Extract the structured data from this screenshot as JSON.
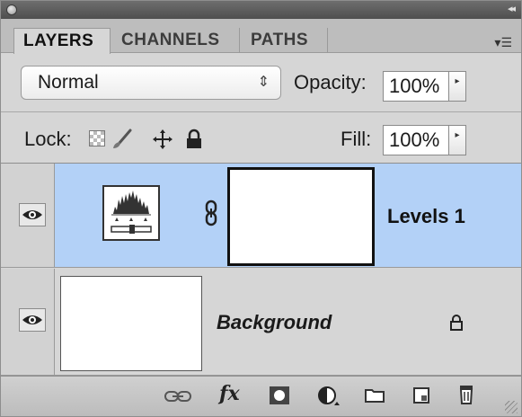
{
  "tabs": [
    {
      "label": "LAYERS",
      "active": true
    },
    {
      "label": "CHANNELS",
      "active": false
    },
    {
      "label": "PATHS",
      "active": false
    }
  ],
  "blend_mode": {
    "value": "Normal"
  },
  "opacity": {
    "label": "Opacity:",
    "value": "100%"
  },
  "lock": {
    "label": "Lock:"
  },
  "fill": {
    "label": "Fill:",
    "value": "100%"
  },
  "layers": [
    {
      "name": "Levels 1",
      "visible": true,
      "selected": true,
      "type": "adjustment-levels",
      "has_mask": true
    },
    {
      "name": "Background",
      "visible": true,
      "selected": false,
      "type": "pixel",
      "locked": true
    }
  ],
  "colors": {
    "selected_row": "#b3d1f7",
    "panel_bg": "#d6d6d6"
  },
  "icons": {
    "bottom_toolbar": [
      "link-layers-icon",
      "fx-icon",
      "add-mask-icon",
      "adjustment-layer-icon",
      "new-group-icon",
      "new-layer-icon",
      "trash-icon"
    ],
    "fx_label": "fx"
  }
}
